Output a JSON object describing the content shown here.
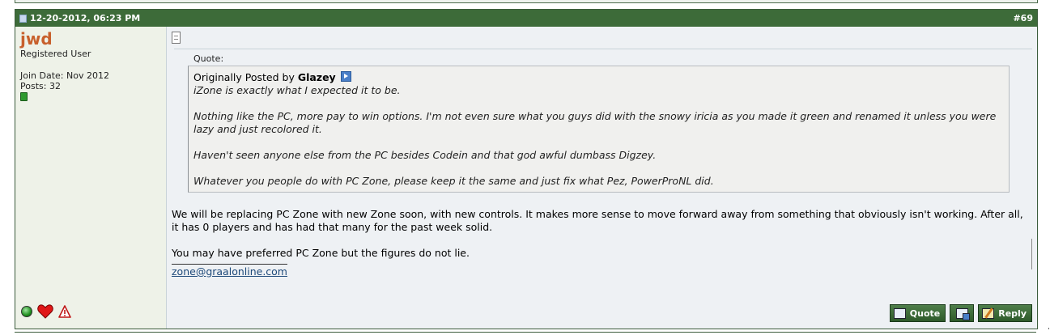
{
  "post": {
    "date": "12-20-2012, 06:23 PM",
    "number": "#69"
  },
  "user": {
    "name": "jwd",
    "title": "Registered User",
    "join_date": "Join Date: Nov 2012",
    "posts": "Posts: 32",
    "icons": [
      "online-status-icon",
      "heart-icon",
      "report-warning-icon"
    ]
  },
  "quote": {
    "label": "Quote:",
    "originally_posted_by": "Originally Posted by",
    "author": "Glazey",
    "paragraphs": [
      "iZone is exactly what I expected it to be.",
      "Nothing like the PC, more pay to win options. I'm not even sure what you guys did with the snowy iricia as you made it green and renamed it unless you were lazy and just recolored it.",
      "Haven't seen anyone else from the PC besides Codein and that god awful dumbass Digzey.",
      "Whatever you people do with PC Zone, please keep it the same and just fix what Pez, PowerProNL did."
    ]
  },
  "message": {
    "paragraph1": "We will be replacing PC Zone with new Zone soon, with new controls. It makes more sense to move forward away from something that obviously isn't working. After all, it has 0 players and has had that many for the past week solid.",
    "paragraph2": "You may have preferred PC Zone but the figures do not lie.",
    "signature": "zone@graalonline.com"
  },
  "buttons": {
    "quote": "Quote",
    "reply": "Reply"
  },
  "colors": {
    "header_green": "#3d6b39",
    "username_orange": "#c8602c",
    "link_blue": "#1e4a7a"
  }
}
